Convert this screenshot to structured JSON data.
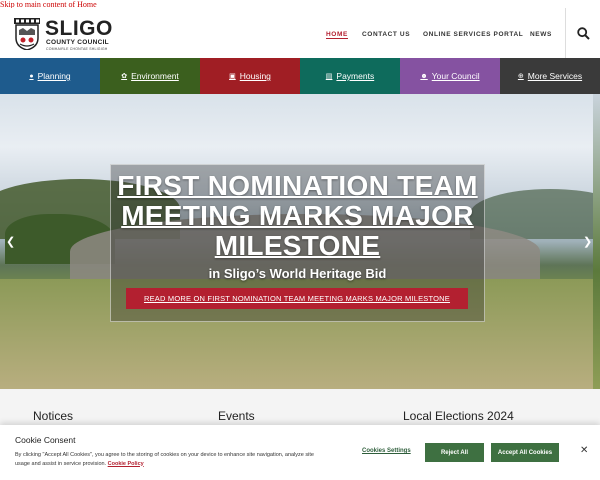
{
  "skip_link": "Skip to main content of Home",
  "logo": {
    "title": "SLIGO",
    "subtitle": "COUNTY COUNCIL",
    "irish": "COMHAIRLE CHONTAE SHLIGIGH"
  },
  "topnav": [
    {
      "label": "HOME",
      "active": true
    },
    {
      "label": "CONTACT US"
    },
    {
      "label": "ONLINE SERVICES PORTAL"
    },
    {
      "label": "NEWS"
    }
  ],
  "search_icon": "search-icon",
  "tiles": [
    {
      "label": "Planning",
      "icon": "pin-icon",
      "color": "#1e5b8d"
    },
    {
      "label": "Environment",
      "icon": "leaf-icon",
      "color": "#3b5f1e"
    },
    {
      "label": "Housing",
      "icon": "building-icon",
      "color": "#a01e24"
    },
    {
      "label": "Payments",
      "icon": "card-icon",
      "color": "#0e6b5c"
    },
    {
      "label": "Your Council",
      "icon": "people-icon",
      "color": "#8552a1"
    },
    {
      "label": "More Services",
      "icon": "plus-circle-icon",
      "color": "#3a3a3a"
    }
  ],
  "hero": {
    "headline": "FIRST NOMINATION TEAM MEETING MARKS MAJOR MILESTONE",
    "subline": "in Sligo’s World Heritage Bid",
    "read_more": "READ MORE ON FIRST NOMINATION TEAM MEETING MARKS MAJOR MILESTONE"
  },
  "sections": [
    {
      "title": "Notices"
    },
    {
      "title": "Events"
    },
    {
      "title": "Local Elections 2024"
    }
  ],
  "cookie": {
    "title": "Cookie Consent",
    "text": "By clicking \"Accept All Cookies\", you agree to the storing of cookies on your device to enhance site navigation, analyze site usage and assist in service provision.",
    "policy_link": "Cookie Policy",
    "settings_label": "Cookies Settings",
    "reject_label": "Reject All",
    "accept_label": "Accept All Cookies"
  },
  "colors": {
    "accent_red": "#b32030",
    "cookie_green": "#3e7041"
  }
}
